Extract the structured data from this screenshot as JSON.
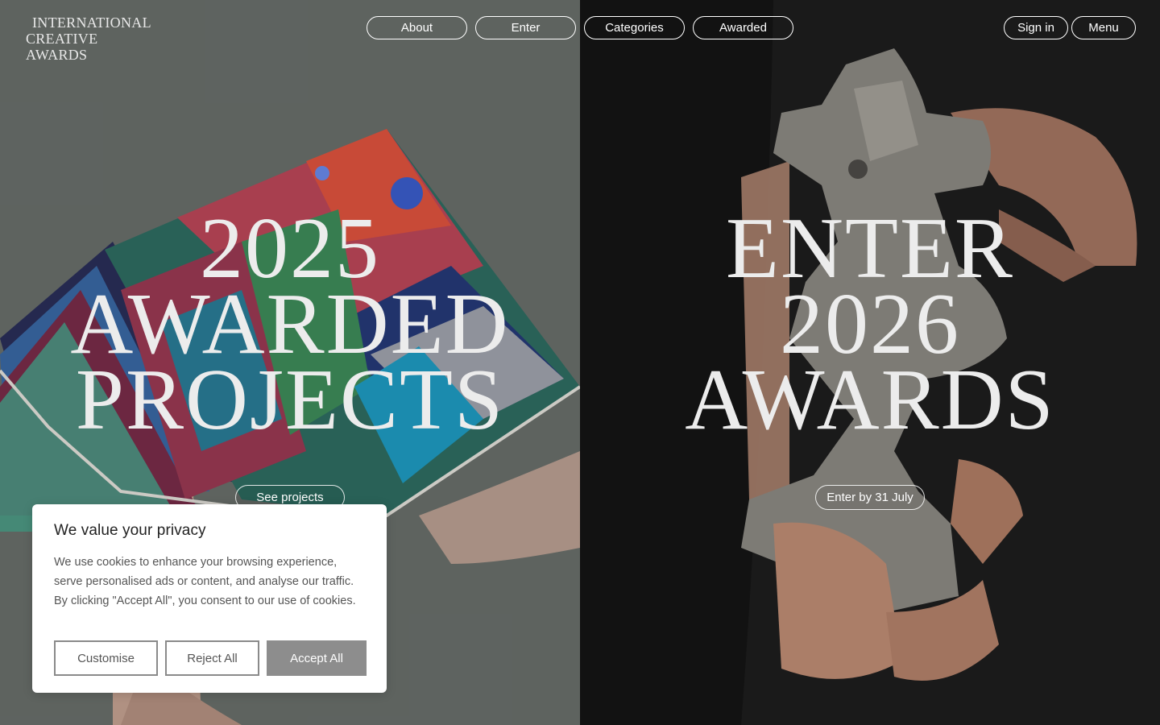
{
  "header": {
    "logo_line1": "INTERNATIONAL",
    "logo_line2": "CREATIVE AWARDS",
    "nav": {
      "about": "About",
      "enter": "Enter",
      "categories": "Categories",
      "awarded": "Awarded",
      "sign_in": "Sign in",
      "menu": "Menu"
    }
  },
  "left_panel": {
    "title_line1": "2025",
    "title_line2": "AWARDED",
    "title_line3": "PROJECTS",
    "cta": "See projects"
  },
  "right_panel": {
    "title_line1": "ENTER",
    "title_line2": "2026",
    "title_line3": "AWARDS",
    "cta": "Enter by 31 July"
  },
  "cookie_banner": {
    "title": "We value your privacy",
    "body": "We use cookies to enhance your browsing experience, serve personalised ads or content, and analyse our traffic. By clicking \"Accept All\", you consent to our use of cookies.",
    "customise": "Customise",
    "reject": "Reject All",
    "accept": "Accept All"
  },
  "colors": {
    "left_bg": "#6b716d",
    "right_bg": "#161616",
    "accept_button": "#8d8d8d"
  }
}
